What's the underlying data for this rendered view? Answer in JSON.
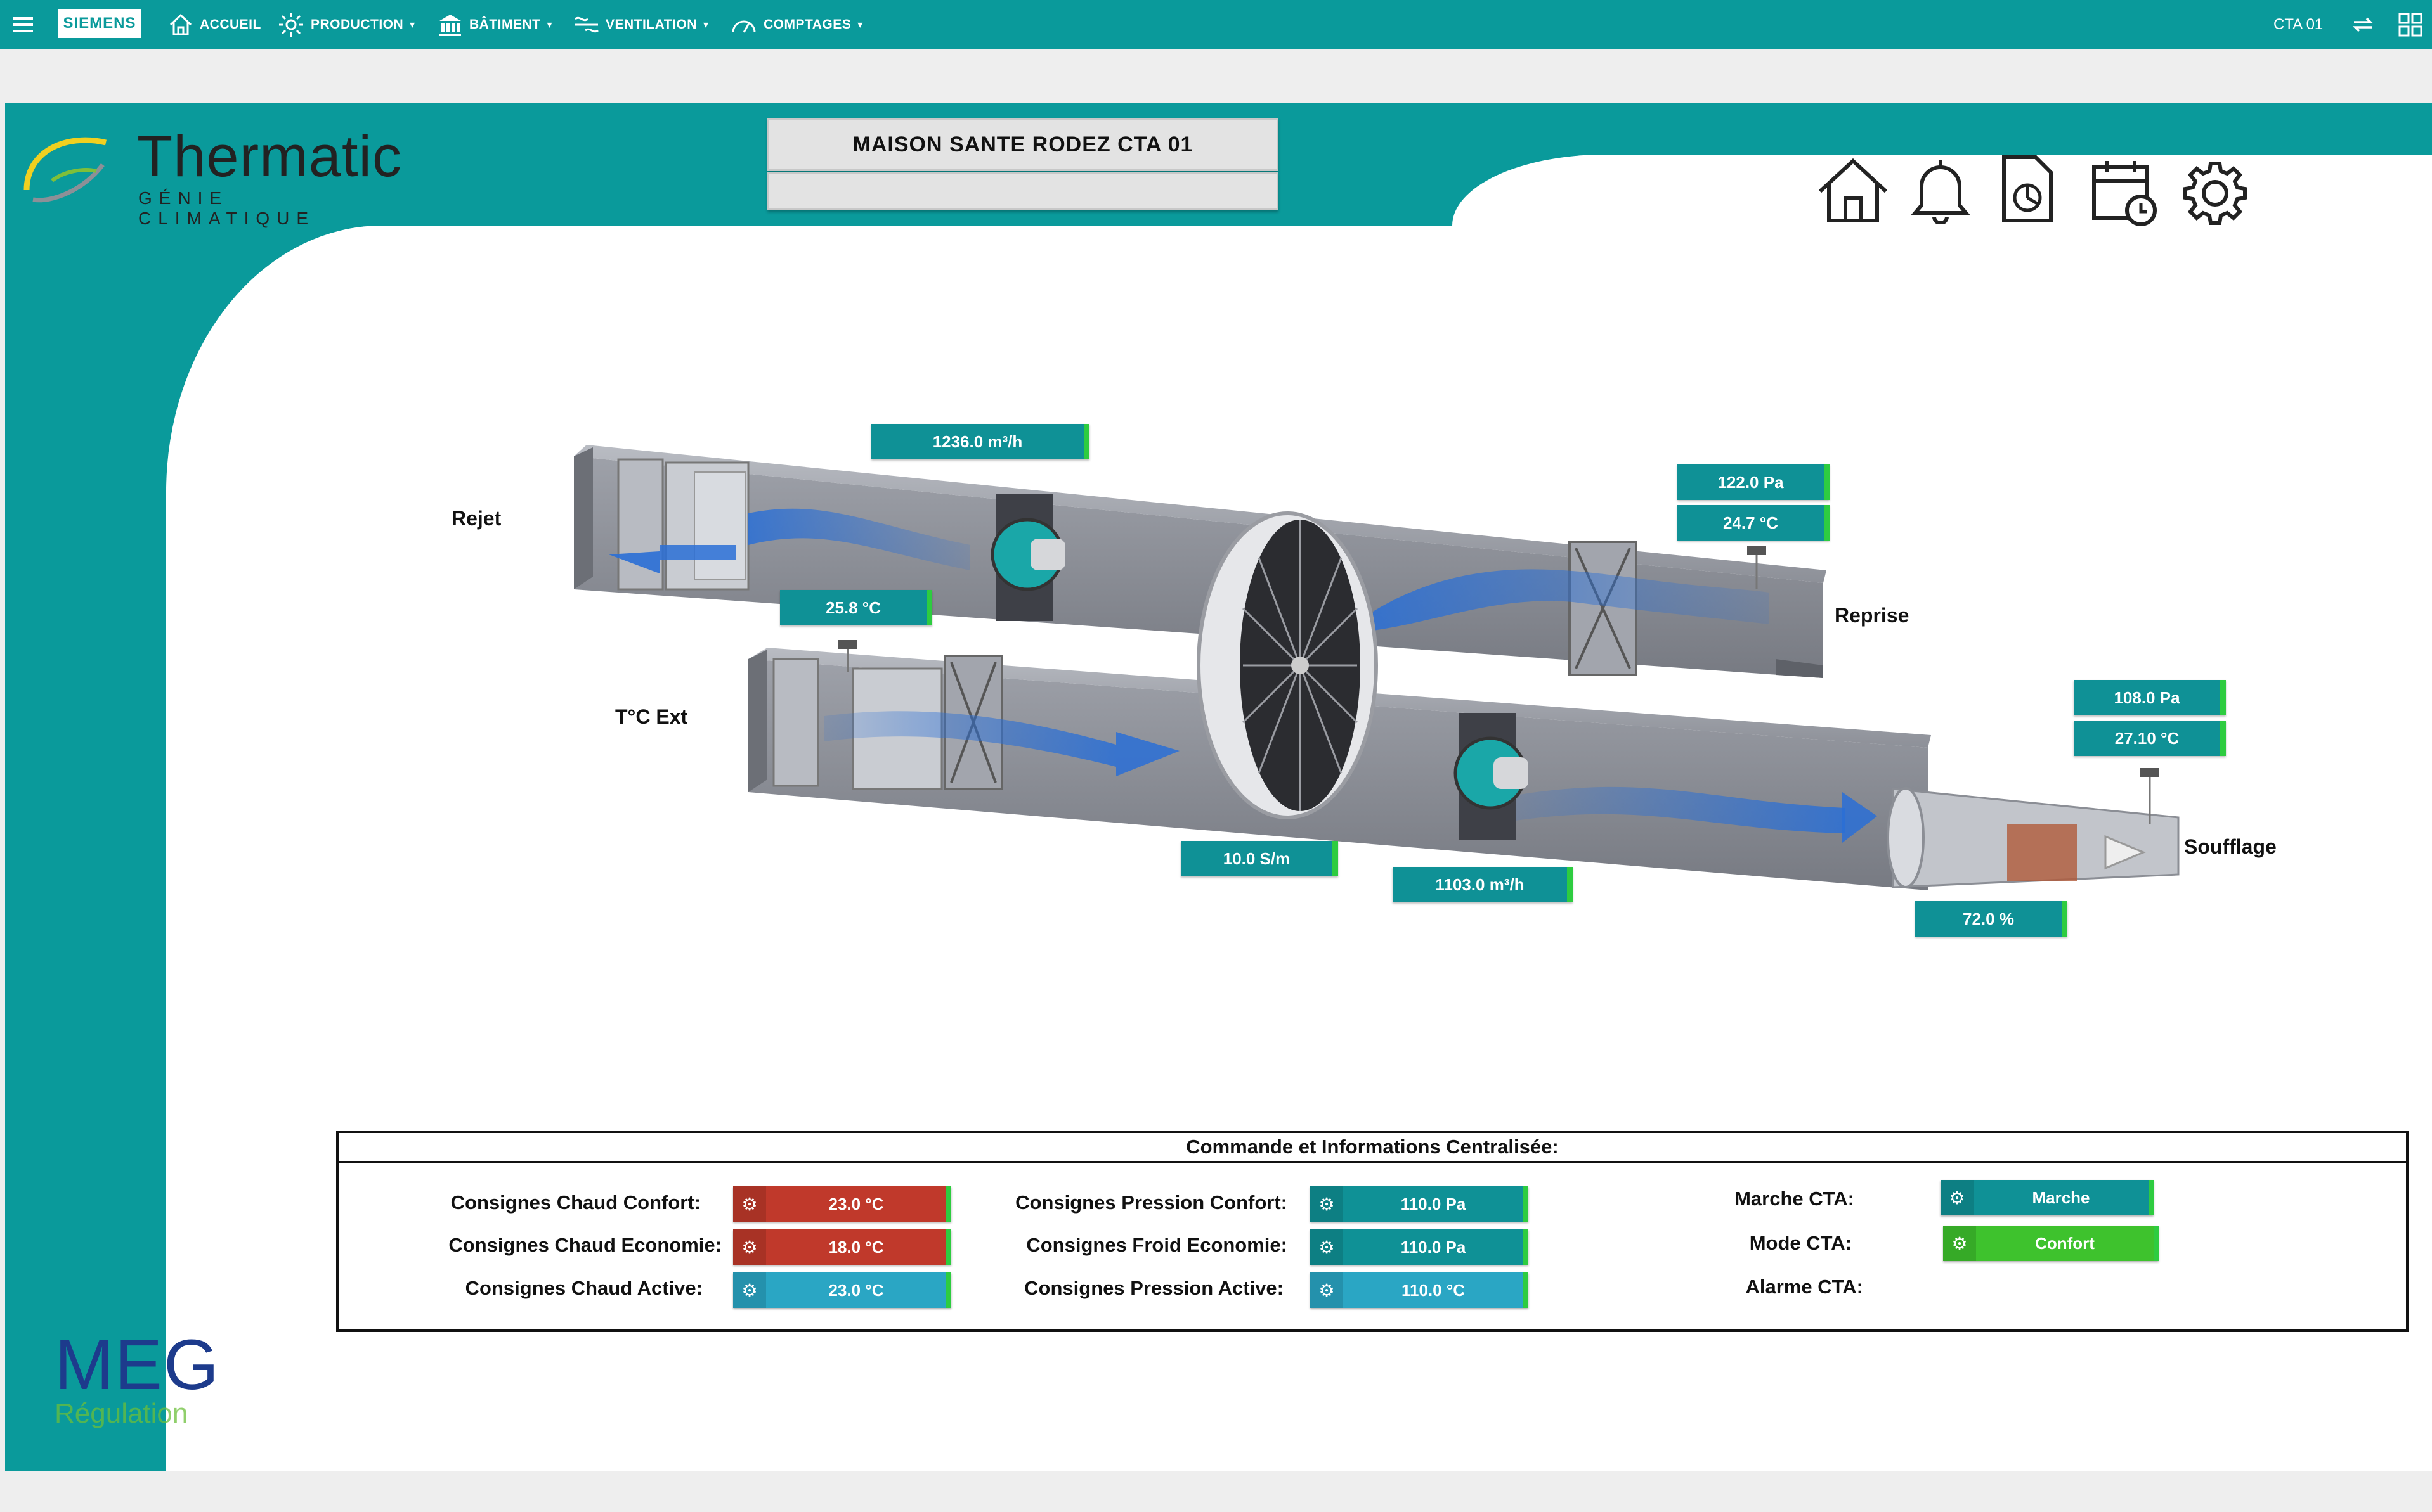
{
  "topnav": {
    "brand": "SIEMENS",
    "items": [
      {
        "label": "ACCUEIL",
        "icon": "home-icon"
      },
      {
        "label": "PRODUCTION",
        "icon": "sun-icon"
      },
      {
        "label": "BÂTIMENT",
        "icon": "building-icon"
      },
      {
        "label": "VENTILATION",
        "icon": "fan-icon"
      },
      {
        "label": "COMPTAGES",
        "icon": "gauge-icon"
      }
    ],
    "page_label": "CTA 01"
  },
  "header": {
    "logo_name": "Thermatic",
    "logo_tagline": "GÉNIE CLIMATIQUE",
    "title": "MAISON SANTE RODEZ CTA 01",
    "subtitle": ""
  },
  "footer_logo": {
    "name": "MEG",
    "sub": "Régulation"
  },
  "diagram": {
    "labels": {
      "rejet": "Rejet",
      "reprise": "Reprise",
      "ext": "T°C Ext",
      "soufflage": "Soufflage"
    },
    "values": {
      "extract_flow": "1236.0 m³/h",
      "reprise_pressure": "122.0 Pa",
      "reprise_temp": "24.7 °C",
      "rejet_temp": "25.8 °C",
      "soufflage_pressure": "108.0 Pa",
      "soufflage_temp": "27.10 °C",
      "wheel_speed": "10.0 S/m",
      "supply_flow": "1103.0 m³/h",
      "valve_pct": "72.0 %"
    }
  },
  "command": {
    "title": "Commande et Informations Centralisée:",
    "col1": [
      {
        "label": "Consignes Chaud Confort:",
        "value": "23.0 °C"
      },
      {
        "label": "Consignes Chaud Economie:",
        "value": "18.0 °C"
      },
      {
        "label": "Consignes Chaud Active:",
        "value": "23.0 °C"
      }
    ],
    "col2": [
      {
        "label": "Consignes Pression Confort:",
        "value": "110.0 Pa"
      },
      {
        "label": "Consignes Froid Economie:",
        "value": "110.0 Pa"
      },
      {
        "label": "Consignes Pression Active:",
        "value": "110.0 °C"
      }
    ],
    "col3": [
      {
        "label": "Marche CTA:",
        "value": "Marche"
      },
      {
        "label": "Mode CTA:",
        "value": "Confort"
      },
      {
        "label": "Alarme CTA:",
        "value": ""
      }
    ]
  },
  "colors": {
    "teal": "#0a9a9b",
    "chip": "#0f9196",
    "red": "#c0392b",
    "green": "#3ec22d",
    "blue": "#2aa6c4"
  }
}
